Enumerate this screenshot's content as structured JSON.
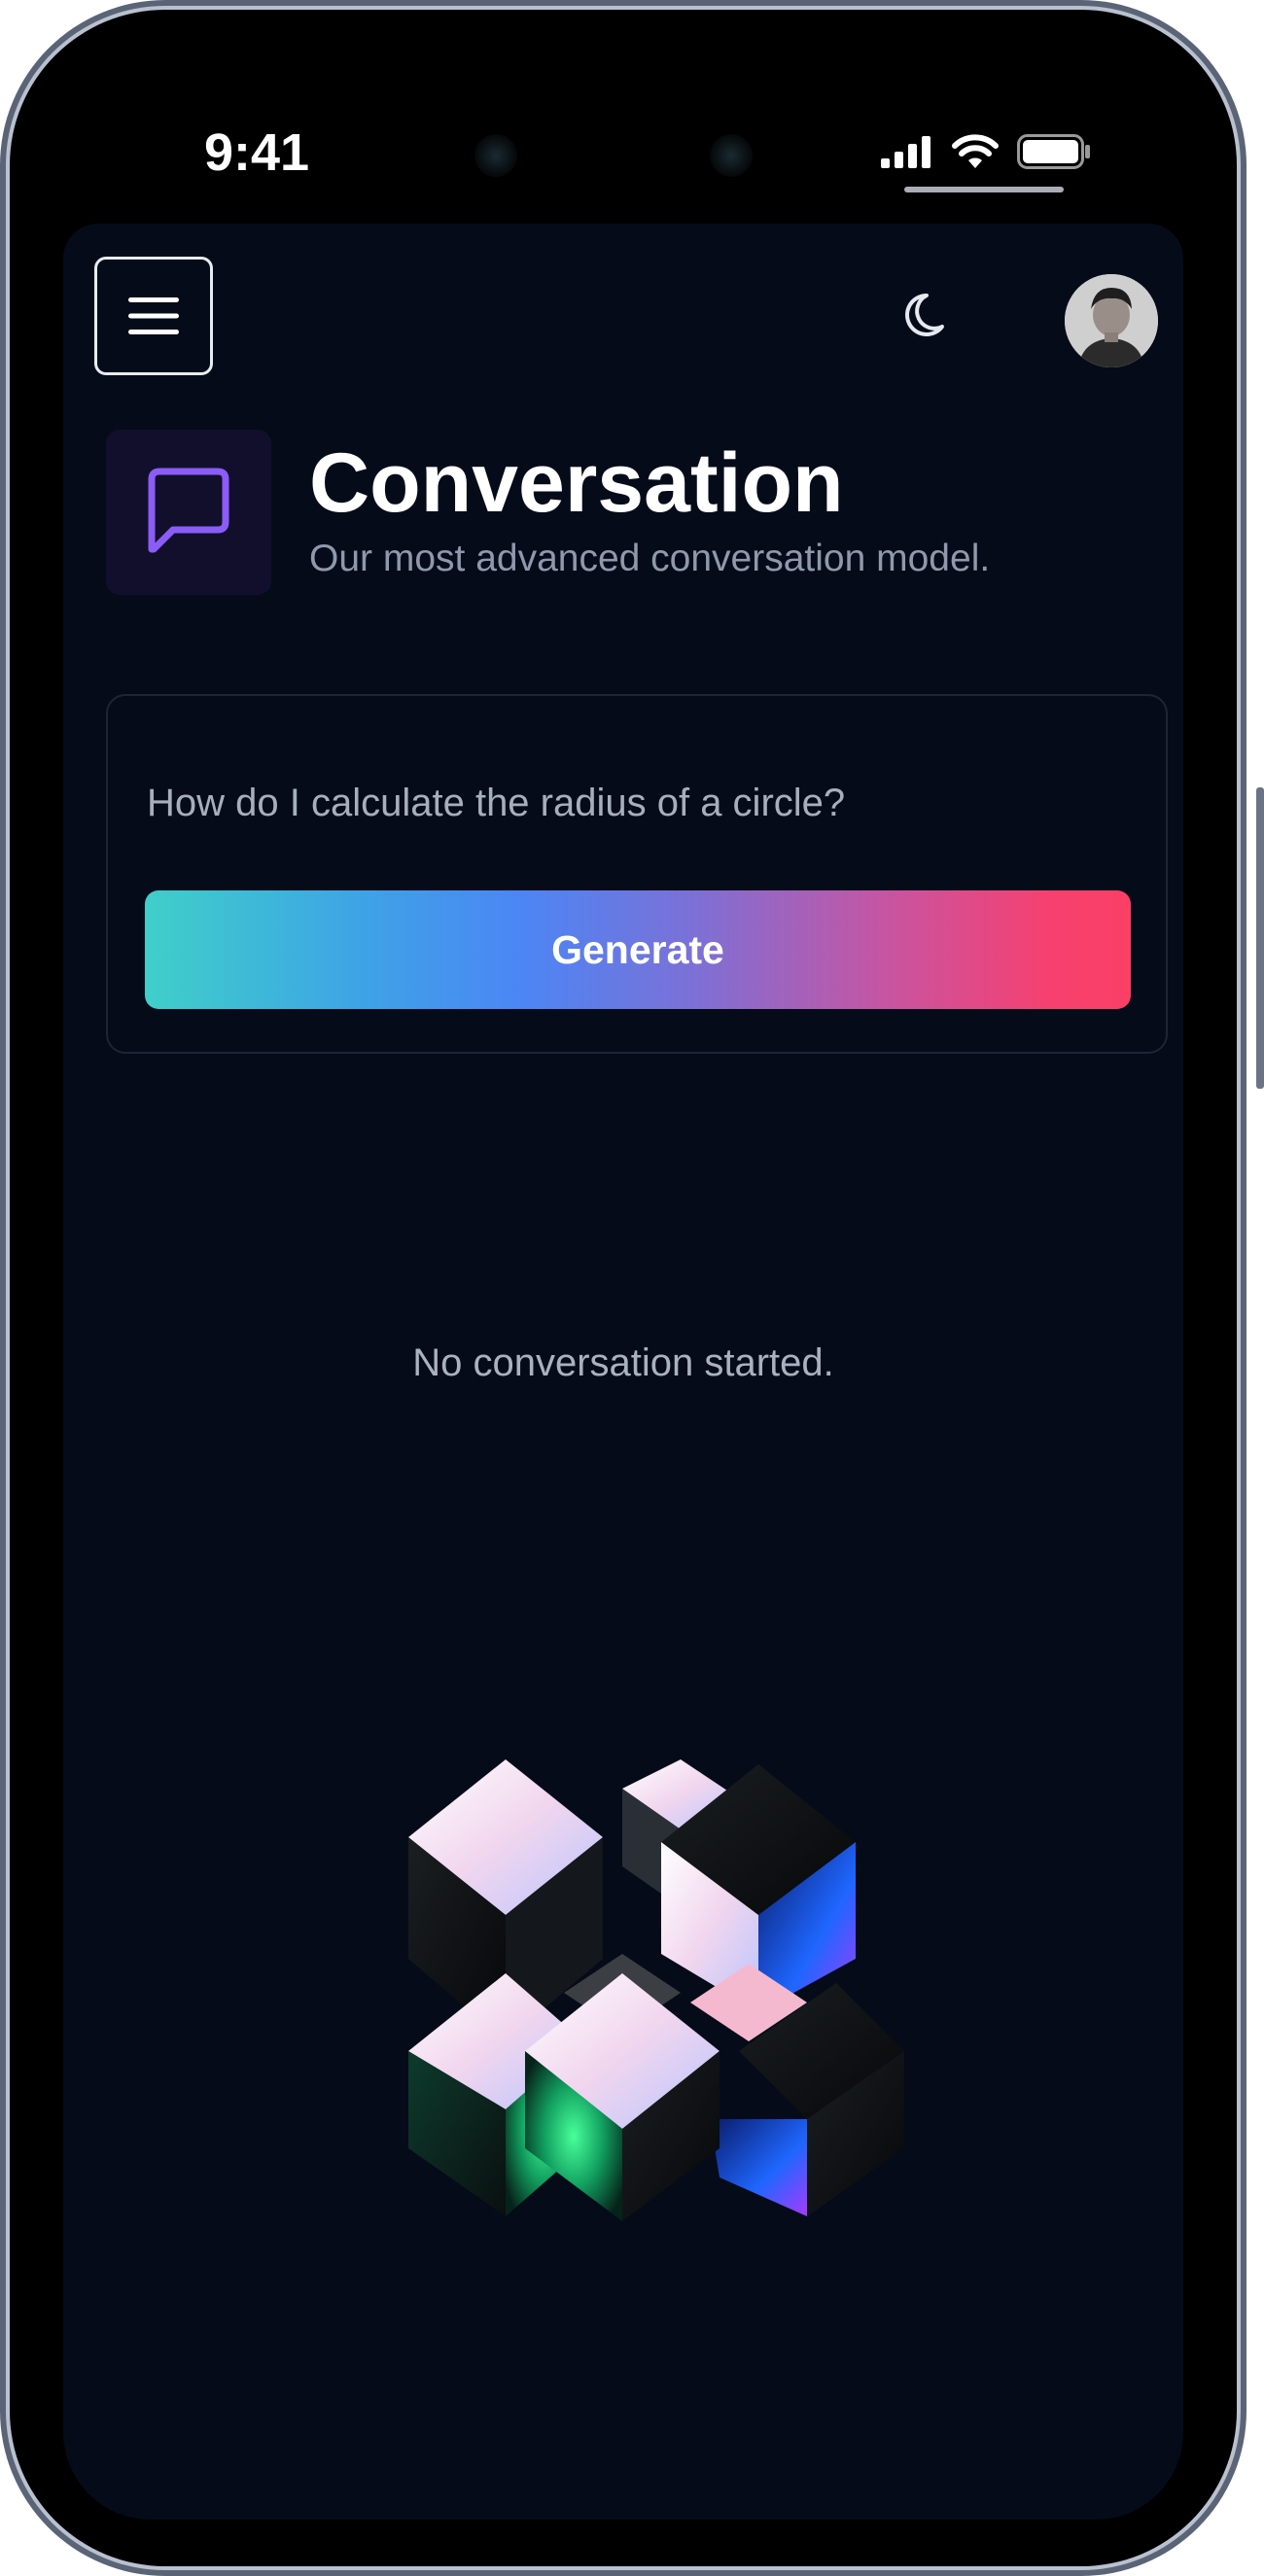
{
  "status_bar": {
    "time": "9:41",
    "icons": [
      "signal-icon",
      "wifi-icon",
      "battery-icon"
    ]
  },
  "header": {
    "menu_icon": "hamburger-menu-icon",
    "theme_icon": "moon-icon",
    "avatar_icon": "user-avatar"
  },
  "page": {
    "icon": "chat-bubble-icon",
    "title": "Conversation",
    "subtitle": "Our most advanced conversation model."
  },
  "prompt": {
    "value": "How do I calculate the radius of a circle?",
    "button_label": "Generate"
  },
  "empty_state": {
    "message": "No conversation started.",
    "illustration": "abstract-cubes-illustration"
  },
  "colors": {
    "background": "#050b19",
    "accent_purple": "#8b5cf6",
    "gradient_start": "#3fcfc9",
    "gradient_mid": "#4b86f5",
    "gradient_end": "#fb3f65"
  }
}
